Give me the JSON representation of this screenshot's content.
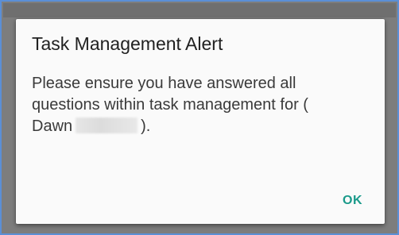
{
  "dialog": {
    "title": "Task Management Alert",
    "message_part1": "Please ensure you have answered all questions within task management for ( Dawn",
    "message_part2": ").",
    "ok_label": "OK"
  },
  "colors": {
    "accent": "#1a9a8a",
    "frame_border": "#5b8fd6",
    "scrim": "#7d7d7d"
  }
}
